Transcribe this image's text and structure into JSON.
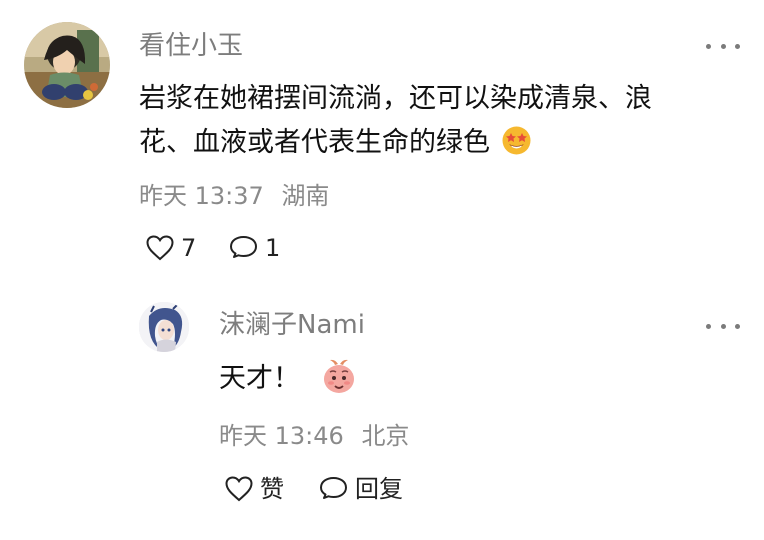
{
  "comment": {
    "username": "看住小玉",
    "text_line1": "岩浆在她裙摆间流淌，还可以染成清泉、浪",
    "text_line2": "花、血液或者代表生命的绿色",
    "time": "昨天 13:37",
    "location": "湖南",
    "likes": "7",
    "replies": "1",
    "emoji": "star-struck-emoji",
    "avatar": "anime-avatar-green-hair"
  },
  "reply": {
    "username": "沫澜子Nami",
    "text": "天才！",
    "time": "昨天 13:46",
    "location": "北京",
    "like_label": "赞",
    "reply_label": "回复",
    "sticker": "peach-sticker",
    "avatar": "anime-avatar-blue-hair"
  },
  "colors": {
    "username": "#7d7d7d",
    "meta": "#8a8a8a",
    "text": "#111111",
    "emoji_face": "#f6b82f",
    "sticker": "#f4a7a0"
  },
  "icons": {
    "like": "heart-outline-icon",
    "comment": "speech-bubble-icon",
    "more": "more-horizontal-icon"
  }
}
